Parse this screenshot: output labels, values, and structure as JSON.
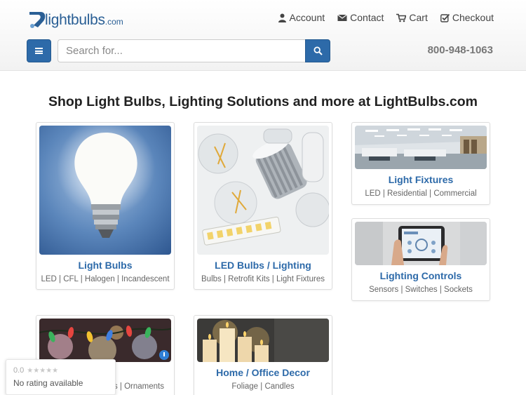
{
  "header": {
    "logo_word": "lightbulbs",
    "logo_tld": ".com",
    "nav": [
      {
        "label": "Account",
        "icon": "user-icon"
      },
      {
        "label": "Contact",
        "icon": "envelope-icon"
      },
      {
        "label": "Cart",
        "icon": "cart-icon"
      },
      {
        "label": "Checkout",
        "icon": "checkout-icon"
      }
    ],
    "search_placeholder": "Search for...",
    "phone": "800-948-1063"
  },
  "headline": "Shop Light Bulbs, Lighting Solutions and more at LightBulbs.com",
  "categories": [
    {
      "title": "Light Bulbs",
      "sub": "LED | CFL | Halogen | Incandescent"
    },
    {
      "title": "LED Bulbs / Lighting",
      "sub": "Bulbs | Retrofit Kits | Light Fixtures"
    },
    {
      "title": "Light Fixtures",
      "sub": "LED | Residential | Commercial"
    },
    {
      "title": "Lighting Controls",
      "sub": "Sensors | Switches | Sockets"
    },
    {
      "title": "mas",
      "sub": "es | Ornaments"
    },
    {
      "title": "Home / Office Decor",
      "sub": "Foliage | Candles"
    }
  ],
  "rating_widget": {
    "score": "0.0",
    "stars": "★★★★★",
    "text": "No rating available"
  },
  "colors": {
    "primary": "#2d6aa9",
    "link": "#2d6aa9",
    "phone": "#777777"
  }
}
